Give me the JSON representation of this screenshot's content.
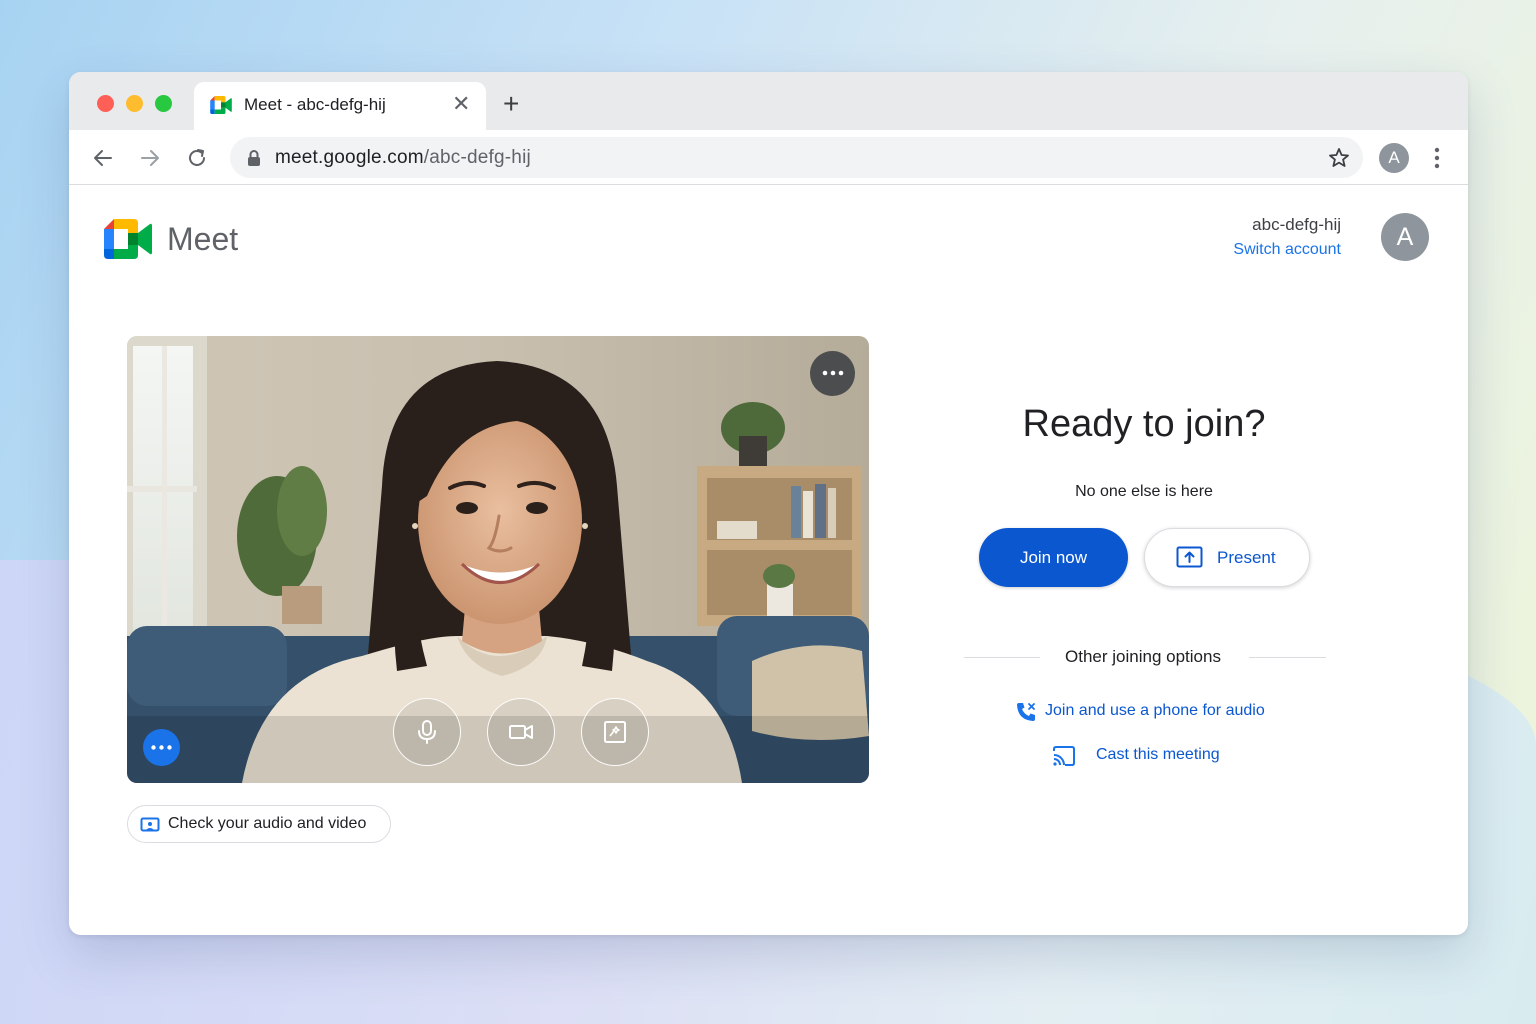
{
  "browser": {
    "tab": {
      "title": "Meet - abc-defg-hij",
      "favicon": "google-meet-icon",
      "close_glyph": "✕"
    },
    "new_tab_glyph": "+",
    "address": {
      "host": "meet.google.com",
      "path": "/abc-defg-hij"
    },
    "profile_initial": "A"
  },
  "header": {
    "app_name": "Meet",
    "account": {
      "meeting_code": "abc-defg-hij",
      "switch_label": "Switch account",
      "avatar_initial": "A"
    }
  },
  "preview": {
    "controls": [
      "microphone-icon",
      "camera-icon",
      "visual-effects-icon"
    ],
    "check_av_label": "Check your audio and video"
  },
  "join_panel": {
    "title": "Ready to join?",
    "status": "No one else is here",
    "join_label": "Join now",
    "present_label": "Present",
    "other_options_label": "Other joining options",
    "options": [
      {
        "icon": "phone-audio-icon",
        "label": "Join and use a phone for audio"
      },
      {
        "icon": "cast-icon",
        "label": "Cast this meeting"
      }
    ]
  },
  "colors": {
    "accent": "#0b57d0",
    "link": "#1a73e8",
    "meet_green": "#00832d",
    "meet_blue": "#0066da",
    "meet_yellow": "#ffba00",
    "meet_red": "#e94235"
  }
}
